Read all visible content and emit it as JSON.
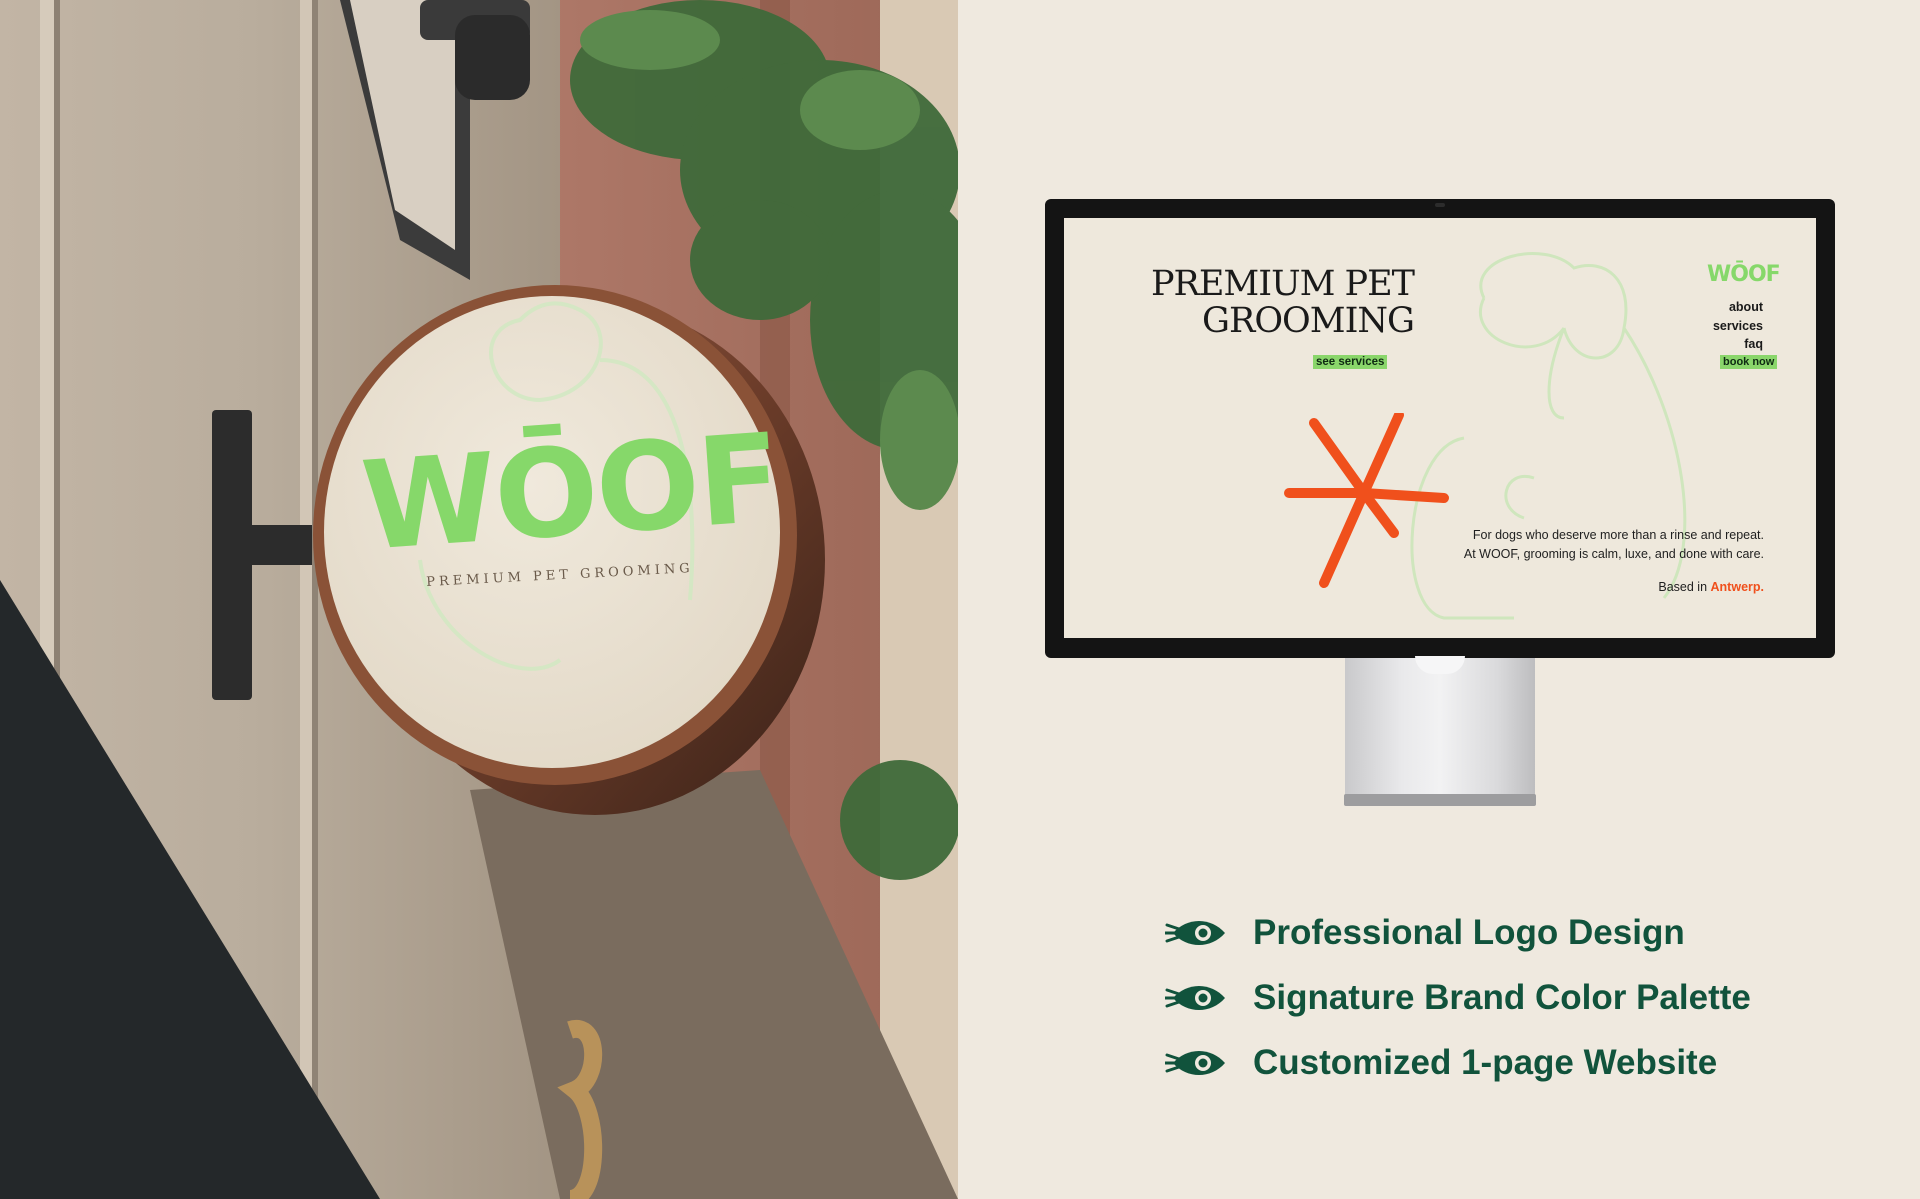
{
  "sign": {
    "logo": "WŌOF",
    "tagline": "PREMIUM PET GROOMING"
  },
  "website": {
    "title_line1": "PREMIUM PET",
    "title_line2": "GROOMING",
    "see_services": "see services",
    "logo": "WŌOF",
    "nav": [
      "about",
      "services",
      "faq"
    ],
    "book_now": "book now",
    "description_line1": "For dogs who deserve more than a rinse and repeat.",
    "description_line2": "At WOOF, grooming is calm, luxe, and done with care.",
    "based_prefix": "Based in",
    "based_city": "Antwerp",
    "based_suffix": "."
  },
  "features": [
    {
      "icon": "eye-rocket-icon",
      "label": "Professional Logo Design"
    },
    {
      "icon": "eye-rocket-icon",
      "label": "Signature Brand Color Palette"
    },
    {
      "icon": "eye-rocket-icon",
      "label": "Customized 1-page Website"
    }
  ],
  "colors": {
    "background": "#efe9df",
    "brand_green": "#86d86a",
    "dark_green": "#11533c",
    "accent_orange": "#f0501c",
    "ink": "#1a1a1a"
  }
}
